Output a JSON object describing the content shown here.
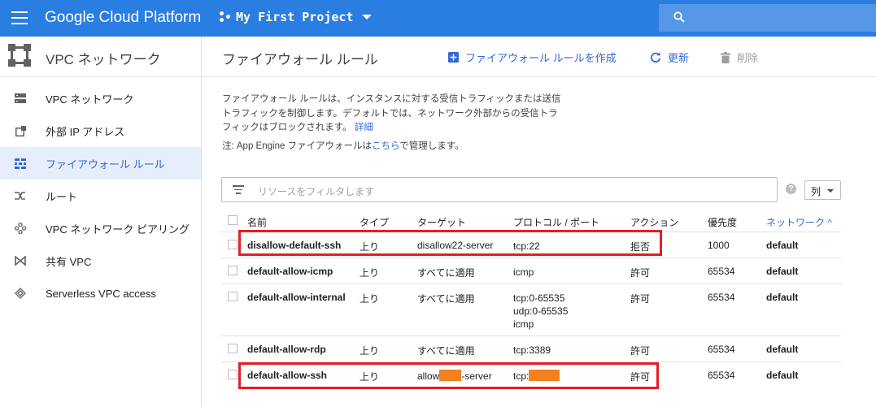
{
  "topbar": {
    "brand": "Google Cloud Platform",
    "project": "My First Project",
    "colors": {
      "bar": "#2a7de1",
      "search": "#5596e6"
    }
  },
  "sidebar": {
    "title": "VPC ネットワーク",
    "items": [
      {
        "label": "VPC ネットワーク",
        "icon": "vpc-network-icon"
      },
      {
        "label": "外部 IP アドレス",
        "icon": "external-ip-icon"
      },
      {
        "label": "ファイアウォール ルール",
        "icon": "firewall-icon",
        "active": true
      },
      {
        "label": "ルート",
        "icon": "routes-icon"
      },
      {
        "label": "VPC ネットワーク ピアリング",
        "icon": "peering-icon"
      },
      {
        "label": "共有 VPC",
        "icon": "shared-vpc-icon"
      },
      {
        "label": "Serverless VPC access",
        "icon": "serverless-icon"
      }
    ]
  },
  "header": {
    "title": "ファイアウォール ルール",
    "create_label": "ファイアウォール ルールを作成",
    "refresh_label": "更新",
    "delete_label": "削除"
  },
  "description": {
    "line1": "ファイアウォール ルールは、インスタンスに対する受信トラフィックまたは送信",
    "line2": "トラフィックを制御します。デフォルトでは、ネットワーク外部からの受信トラ",
    "line3": "フィックはブロックされます。",
    "link": "詳細"
  },
  "note": {
    "prefix": "注: App Engine ファイアウォールは",
    "link": "こちら",
    "suffix": "で管理します。"
  },
  "filter": {
    "placeholder": "リソースをフィルタします",
    "columns_label": "列"
  },
  "table": {
    "headers": {
      "name": "名前",
      "type": "タイプ",
      "target": "ターゲット",
      "protocol": "プロトコル / ポート",
      "action": "アクション",
      "priority": "優先度",
      "network": "ネットワーク ^"
    },
    "rows": [
      {
        "name": "disallow-default-ssh",
        "type": "上り",
        "target": "disallow22-server",
        "protocol": [
          "tcp:22"
        ],
        "action": "拒否",
        "priority": "1000",
        "network": "default",
        "highlight": true
      },
      {
        "name": "default-allow-icmp",
        "type": "上り",
        "target": "すべてに適用",
        "protocol": [
          "icmp"
        ],
        "action": "許可",
        "priority": "65534",
        "network": "default"
      },
      {
        "name": "default-allow-internal",
        "type": "上り",
        "target": "すべてに適用",
        "protocol": [
          "tcp:0-65535",
          "udp:0-65535",
          "icmp"
        ],
        "action": "許可",
        "priority": "65534",
        "network": "default"
      },
      {
        "name": "default-allow-rdp",
        "type": "上り",
        "target": "すべてに適用",
        "protocol": [
          "tcp:3389"
        ],
        "action": "許可",
        "priority": "65534",
        "network": "default"
      },
      {
        "name": "default-allow-ssh",
        "type": "上り",
        "target_prefix": "allow",
        "target_suffix": "-server",
        "protocol_prefix": "tcp:",
        "action": "許可",
        "priority": "65534",
        "network": "default",
        "highlight": true,
        "redacted": true
      }
    ]
  },
  "colors": {
    "link": "#3367d6",
    "highlight": "#e31e24",
    "redaction": "#f4811f"
  }
}
